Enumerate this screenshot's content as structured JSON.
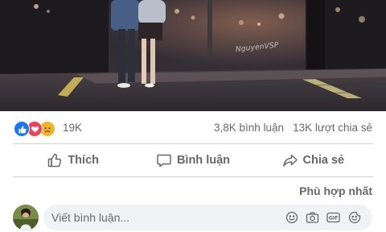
{
  "post": {
    "photo": {
      "watermark": "NguyenVSP"
    },
    "reactions": {
      "count": "19K",
      "types": [
        "like-icon",
        "love-icon",
        "sad-icon"
      ]
    },
    "stats": {
      "comments": "3,8K bình luận",
      "shares": "13K lượt chia sẻ"
    },
    "actions": {
      "like": "Thích",
      "comment": "Bình luận",
      "share": "Chia sẻ"
    },
    "sort_label": "Phù hợp nhất",
    "composer": {
      "placeholder": "Viết bình luận..."
    }
  },
  "colors": {
    "like": "#1877f2",
    "love": "#f33e58",
    "sad": "#f7b125",
    "secondary_text": "#65676b",
    "composer_bg": "#f0f2f5",
    "divider": "#ced0d4"
  }
}
